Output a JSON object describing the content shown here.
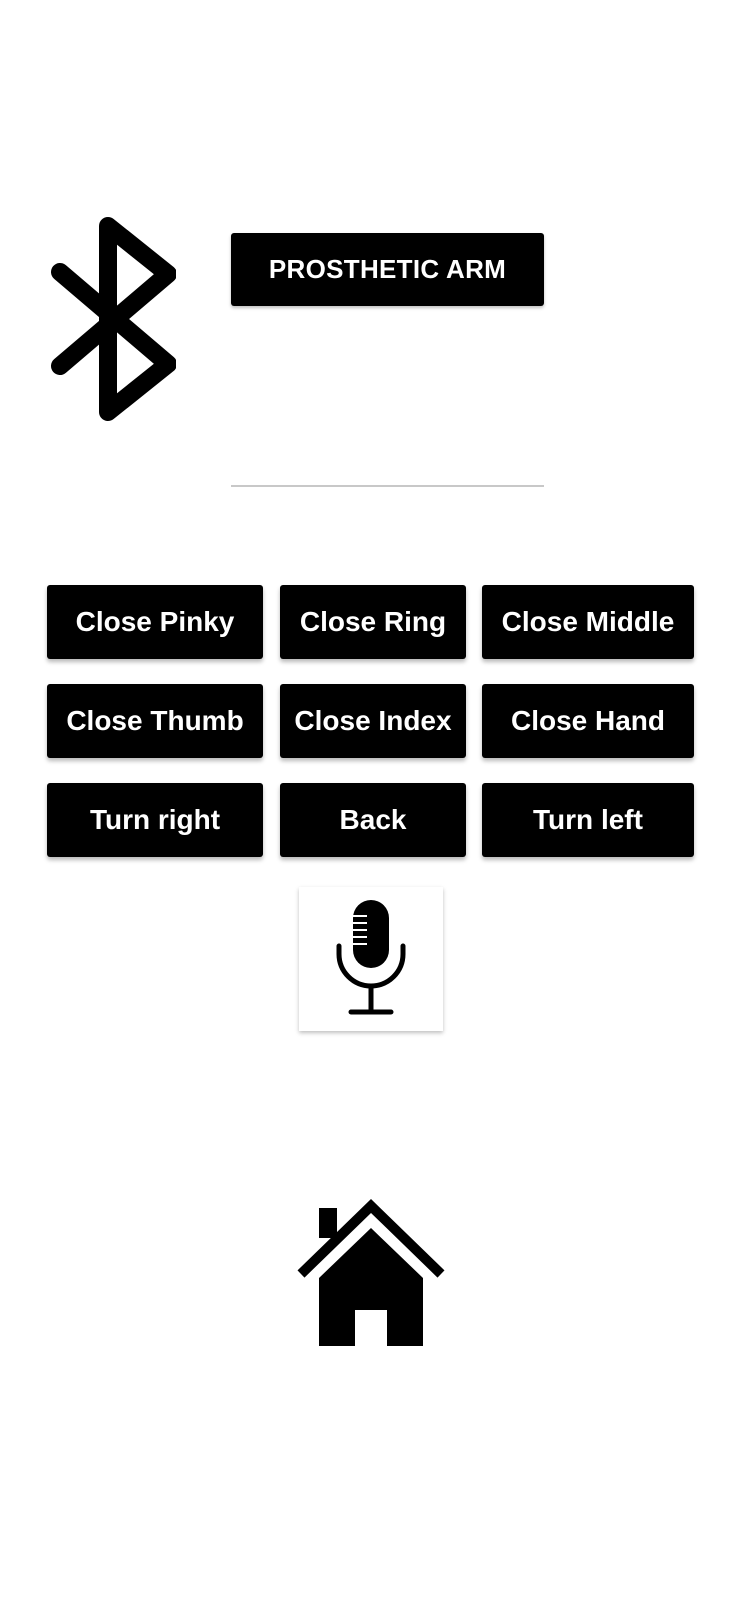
{
  "header": {
    "bluetooth_icon": "bluetooth-icon",
    "device_button_label": "PROSTHETIC ARM"
  },
  "controls": {
    "rows": [
      [
        "Close Pinky",
        "Close Ring",
        "Close Middle"
      ],
      [
        "Close Thumb",
        "Close Index",
        "Close Hand"
      ],
      [
        "Turn right",
        "Back",
        "Turn left"
      ]
    ]
  },
  "voice": {
    "icon": "microphone-icon"
  },
  "nav": {
    "home_icon": "home-icon"
  },
  "colors": {
    "button_bg": "#000000",
    "button_text": "#ffffff",
    "background": "#ffffff",
    "divider": "#c8c8c8"
  }
}
